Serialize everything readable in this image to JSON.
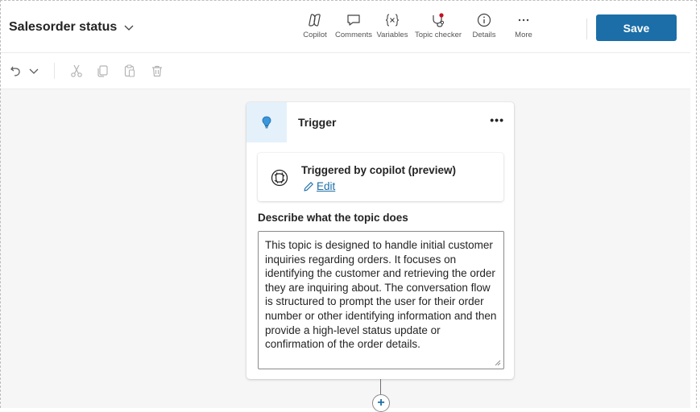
{
  "header": {
    "title": "Salesorder status",
    "tools": [
      {
        "label": "Copilot",
        "icon": "copilot-icon"
      },
      {
        "label": "Comments",
        "icon": "comment-icon"
      },
      {
        "label": "Variables",
        "icon": "variables-icon"
      },
      {
        "label": "Topic checker",
        "icon": "topic-checker-icon"
      },
      {
        "label": "Details",
        "icon": "info-icon"
      },
      {
        "label": "More",
        "icon": "more-icon"
      }
    ],
    "save_label": "Save",
    "accent": "#1b6ea8",
    "checker_dot_color": "#c50f1f"
  },
  "toolbar": {
    "icons": [
      "undo-icon",
      "chevron-down-icon",
      "cut-icon",
      "copy-icon",
      "paste-icon",
      "delete-icon"
    ]
  },
  "trigger_card": {
    "title": "Trigger",
    "more": "•••",
    "inner_title": "Triggered by copilot (preview)",
    "edit_label": "Edit",
    "description_label": "Describe what the topic does",
    "description": "This topic is designed to handle initial customer inquiries regarding orders. It focuses on identifying the customer and retrieving the order they are inquiring about. The conversation flow is structured to prompt the user for their order number or other identifying information and then provide a high-level status update or confirmation of the order details."
  },
  "add_node_label": "+"
}
